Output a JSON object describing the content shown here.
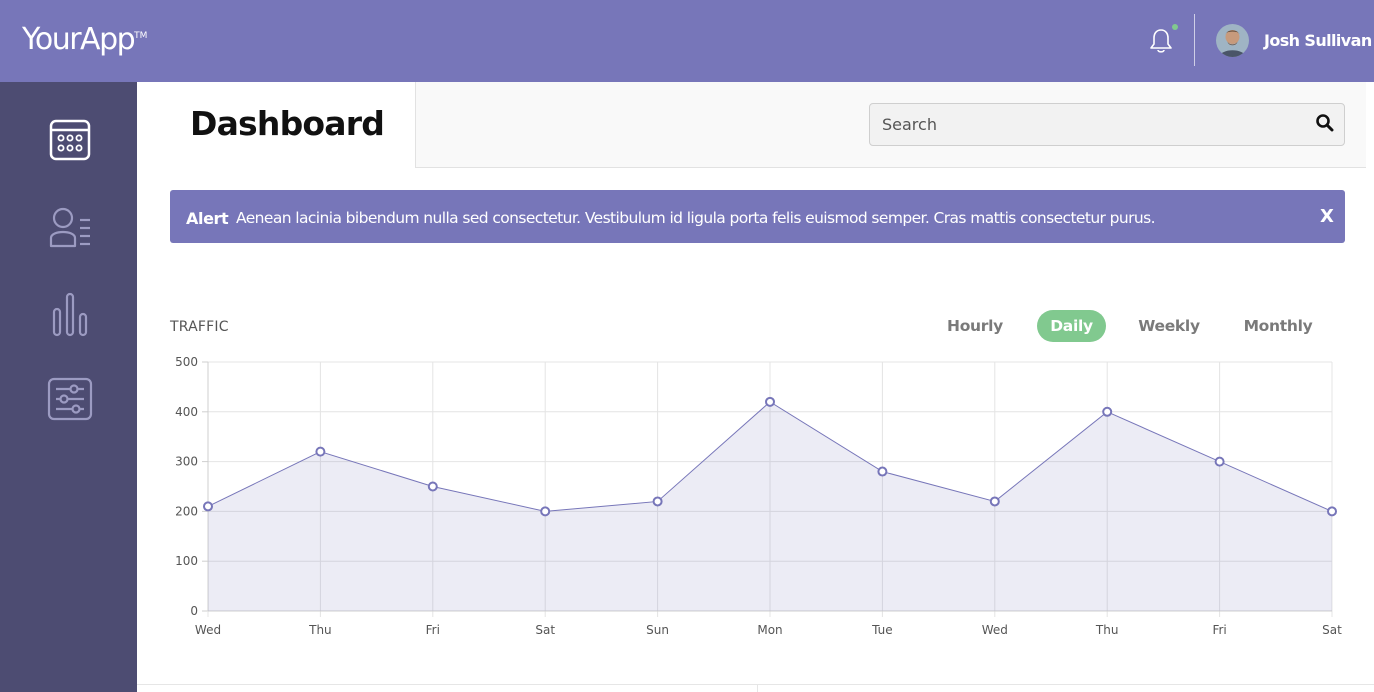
{
  "app": {
    "logo": "YourApp",
    "logo_tm": "TM"
  },
  "header": {
    "user_name": "Josh Sullivan",
    "notification_dot_color": "#81c98f"
  },
  "sidebar": {
    "items": [
      {
        "name": "dashboard",
        "icon": "calendar-grid-icon"
      },
      {
        "name": "members",
        "icon": "user-list-icon"
      },
      {
        "name": "reports",
        "icon": "bar-chart-icon"
      },
      {
        "name": "settings",
        "icon": "sliders-icon"
      }
    ]
  },
  "page": {
    "title": "Dashboard"
  },
  "search": {
    "placeholder": "Search"
  },
  "alert": {
    "label": "Alert",
    "text": "Aenean lacinia bibendum nulla sed consectetur. Vestibulum id ligula porta felis euismod semper. Cras mattis consectetur purus.",
    "close": "X"
  },
  "traffic": {
    "label": "TRAFFIC",
    "tabs": [
      {
        "label": "Hourly",
        "active": false
      },
      {
        "label": "Daily",
        "active": true
      },
      {
        "label": "Weekly",
        "active": false
      },
      {
        "label": "Monthly",
        "active": false
      }
    ]
  },
  "colors": {
    "brand": "#7776b9",
    "sidebar": "#4d4c72",
    "accent_green": "#81c98f"
  },
  "chart_data": {
    "type": "area",
    "categories": [
      "Wed",
      "Thu",
      "Fri",
      "Sat",
      "Sun",
      "Mon",
      "Tue",
      "Wed",
      "Thu",
      "Fri",
      "Sat"
    ],
    "series": [
      {
        "values": [
          210,
          320,
          250,
          200,
          220,
          420,
          280,
          220,
          400,
          300,
          200
        ]
      }
    ],
    "ylim": [
      0,
      500
    ],
    "yticks": [
      0,
      100,
      200,
      300,
      400,
      500
    ],
    "grid": true
  }
}
